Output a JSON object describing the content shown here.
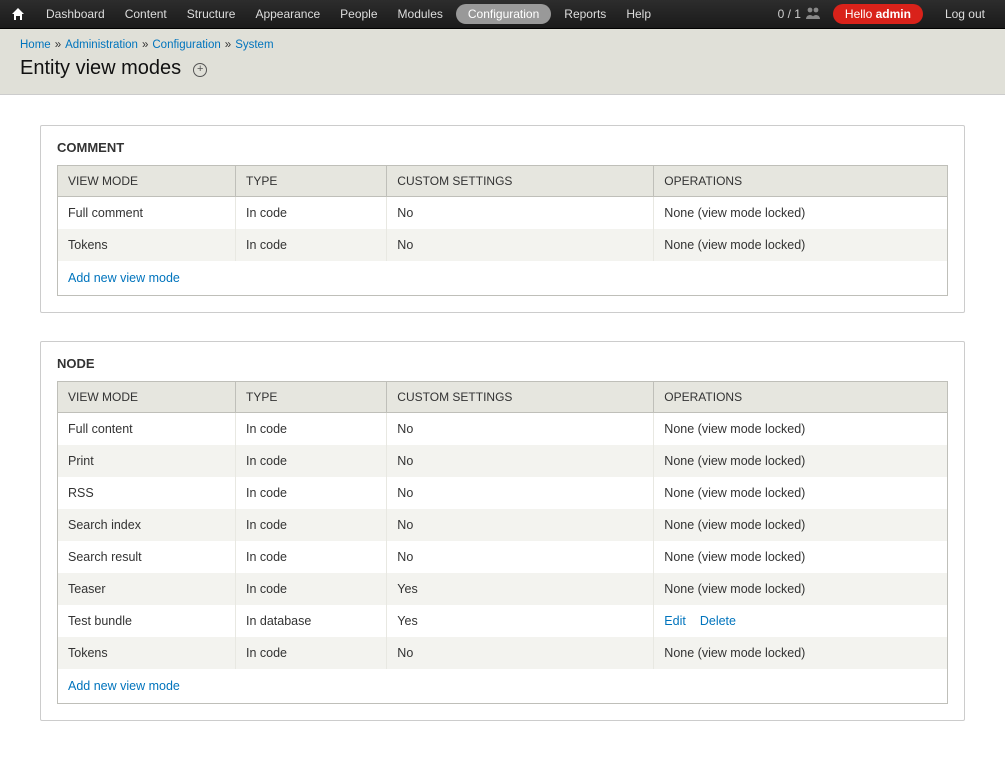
{
  "topnav": {
    "items": [
      "Dashboard",
      "Content",
      "Structure",
      "Appearance",
      "People",
      "Modules",
      "Configuration",
      "Reports",
      "Help"
    ],
    "active_index": 6,
    "counter": "0 / 1",
    "hello_prefix": "Hello ",
    "hello_user": "admin",
    "logout": "Log out"
  },
  "breadcrumb": {
    "items": [
      "Home",
      "Administration",
      "Configuration",
      "System"
    ]
  },
  "page": {
    "title": "Entity view modes"
  },
  "table_headers": {
    "view_mode": "View mode",
    "type": "Type",
    "custom": "Custom settings",
    "ops": "Operations"
  },
  "labels": {
    "add_new": "Add new view mode",
    "edit": "Edit",
    "delete": "Delete",
    "locked": "None (view mode locked)"
  },
  "sections": [
    {
      "title": "Comment",
      "rows": [
        {
          "view_mode": "Full comment",
          "type": "In code",
          "custom": "No",
          "locked": true
        },
        {
          "view_mode": "Tokens",
          "type": "In code",
          "custom": "No",
          "locked": true
        }
      ]
    },
    {
      "title": "Node",
      "rows": [
        {
          "view_mode": "Full content",
          "type": "In code",
          "custom": "No",
          "locked": true
        },
        {
          "view_mode": "Print",
          "type": "In code",
          "custom": "No",
          "locked": true
        },
        {
          "view_mode": "RSS",
          "type": "In code",
          "custom": "No",
          "locked": true
        },
        {
          "view_mode": "Search index",
          "type": "In code",
          "custom": "No",
          "locked": true
        },
        {
          "view_mode": "Search result",
          "type": "In code",
          "custom": "No",
          "locked": true
        },
        {
          "view_mode": "Teaser",
          "type": "In code",
          "custom": "Yes",
          "locked": true
        },
        {
          "view_mode": "Test bundle",
          "type": "In database",
          "custom": "Yes",
          "locked": false
        },
        {
          "view_mode": "Tokens",
          "type": "In code",
          "custom": "No",
          "locked": true
        }
      ]
    }
  ]
}
